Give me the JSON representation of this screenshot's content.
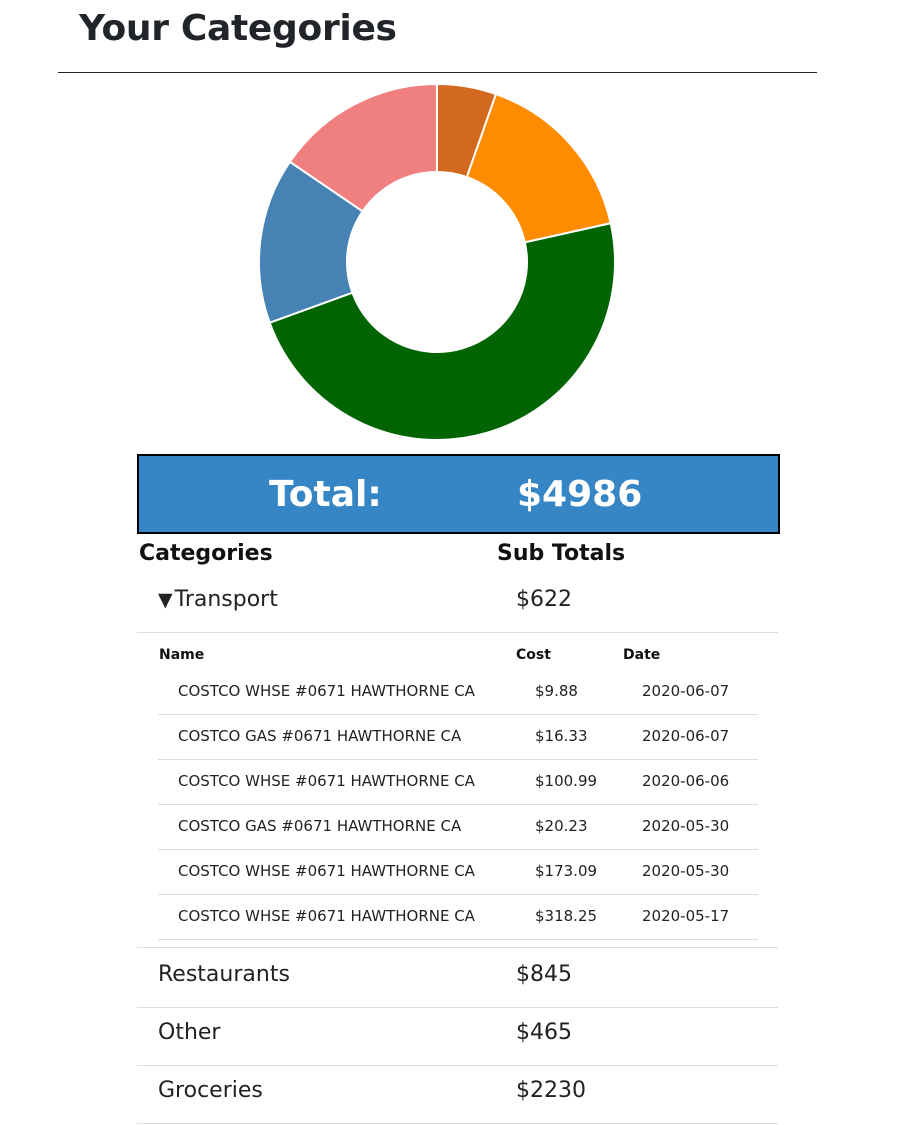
{
  "page": {
    "title": "Your Categories"
  },
  "total": {
    "label": "Total:",
    "value": "$4986"
  },
  "table_headers": {
    "categories": "Categories",
    "subtotals": "Sub Totals"
  },
  "categories": [
    {
      "name": "Transport",
      "subtotal": "$622",
      "expanded": true,
      "caret": "▼"
    },
    {
      "name": "Restaurants",
      "subtotal": "$845"
    },
    {
      "name": "Other",
      "subtotal": "$465"
    },
    {
      "name": "Groceries",
      "subtotal": "$2230"
    }
  ],
  "transactions": {
    "headers": {
      "name": "Name",
      "cost": "Cost",
      "date": "Date"
    },
    "rows": [
      {
        "name": "COSTCO WHSE #0671 HAWTHORNE CA",
        "cost": "$9.88",
        "date": "2020-06-07"
      },
      {
        "name": "COSTCO GAS #0671 HAWTHORNE CA",
        "cost": "$16.33",
        "date": "2020-06-07"
      },
      {
        "name": "COSTCO WHSE #0671 HAWTHORNE CA",
        "cost": "$100.99",
        "date": "2020-06-06"
      },
      {
        "name": "COSTCO GAS #0671 HAWTHORNE CA",
        "cost": "$20.23",
        "date": "2020-05-30"
      },
      {
        "name": "COSTCO WHSE #0671 HAWTHORNE CA",
        "cost": "$173.09",
        "date": "2020-05-30"
      },
      {
        "name": "COSTCO WHSE #0671 HAWTHORNE CA",
        "cost": "$318.25",
        "date": "2020-05-17"
      }
    ]
  },
  "chart_data": {
    "type": "pie",
    "slices": [
      {
        "value": 250,
        "color": "#d2691e"
      },
      {
        "value": 750,
        "color": "#ff8c00"
      },
      {
        "value": 2230,
        "color": "#006400"
      },
      {
        "value": 700,
        "color": "#4682b4"
      },
      {
        "value": 720,
        "color": "#f08080"
      }
    ]
  }
}
